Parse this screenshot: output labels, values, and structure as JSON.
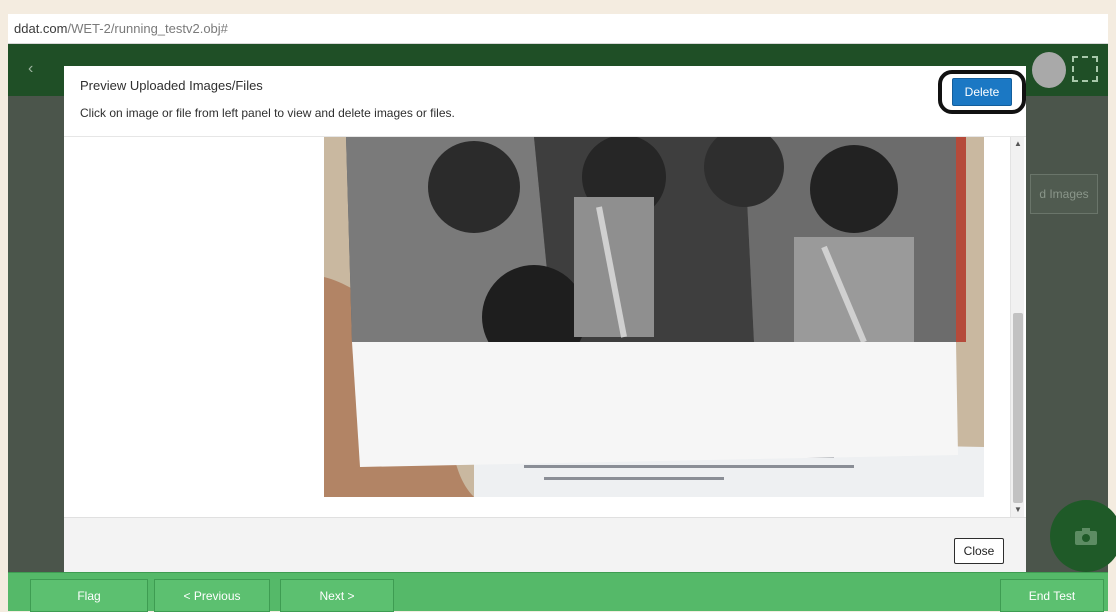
{
  "browser": {
    "url_host": "ddat.com",
    "url_path": "/WET-2/running_testv2.obj#"
  },
  "app": {
    "back_glyph": "‹",
    "side_button_label": "d Images",
    "camera_icon": "camera-icon"
  },
  "modal": {
    "title": "Preview Uploaded Images/Files",
    "subtitle": "Click on image or file from left panel to view and delete images or files.",
    "delete_label": "Delete",
    "close_label": "Close",
    "highlight_color": "#111111",
    "delete_color": "#1b78c4"
  },
  "footer": {
    "flag_label": "Flag",
    "previous_label": "< Previous",
    "next_label": "Next >",
    "end_label": "End Test"
  },
  "colors": {
    "header_green": "#1f4f26",
    "footer_green": "#55b969"
  }
}
